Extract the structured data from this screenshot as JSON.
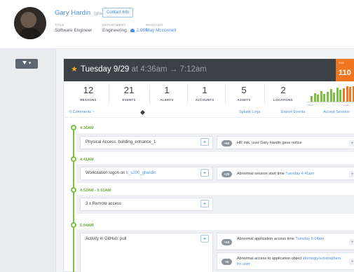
{
  "user": {
    "name": "Gary Hardin",
    "handle": "(ghardin)",
    "contact_label": "Contact Info",
    "title_label": "TITLE",
    "title_value": "Software Engineer",
    "department_label": "DEPARTMENT",
    "department_value": "Engineering",
    "department_count": "2,069",
    "manager_label": "MANAGER",
    "manager_value": "May Mcconnell"
  },
  "filter_label": "▾",
  "session": {
    "star": "★",
    "date": "Tuesday 9/29",
    "time_range": "at 4:36am → 7:12am",
    "risk_label": "RISK",
    "risk_score": "110",
    "stats": [
      {
        "value": "12",
        "label": "REASONS"
      },
      {
        "value": "21",
        "label": "EVENTS"
      },
      {
        "value": "1",
        "label": "ALERTS"
      },
      {
        "value": "1",
        "label": "ACCOUNTS"
      },
      {
        "value": "5",
        "label": "ASSETS"
      },
      {
        "value": "2",
        "label": "LOCATIONS"
      }
    ],
    "sparkline": {
      "bars": [
        0.35,
        0.55,
        0.45,
        0.7,
        0.5,
        0.65,
        0.8,
        0.6,
        0.9,
        0.75,
        0.85,
        1.0,
        0.95,
        1.0
      ],
      "colors": [
        "#7bc043",
        "#7bc043",
        "#7bc043",
        "#7bc043",
        "#7bc043",
        "#7bc043",
        "#7bc043",
        "#7bc043",
        "#7bc043",
        "#7bc043",
        "#f0761f",
        "#f0761f",
        "#f0761f",
        "#f0761f"
      ],
      "start_label": "4:36AM",
      "end_label": "7:12AM"
    },
    "comments_label": "0 Comments ~",
    "splunk_label": "Splunk Logs",
    "export_label": "Export Events",
    "accept_label": "Accept Session"
  },
  "timeline": [
    {
      "time": "4:36AM",
      "event": "Physical Access: building_entrance_1",
      "event_link": "",
      "reasons": [
        {
          "score": "+50",
          "text": "HR risk, user Gary Hardin gave notice",
          "link": ""
        }
      ]
    },
    {
      "time": "4:41AM",
      "event": "Workstation logon on ",
      "event_link": "lt_s200_ghardin",
      "reasons": [
        {
          "score": "+20",
          "text": "Abnormal session start time ",
          "link": "Tuesday 4:41am"
        }
      ]
    },
    {
      "time": "4:52AM - 5:01AM",
      "event": "3 x Remote access",
      "event_link": "",
      "reasons": []
    },
    {
      "time": "5:04AM",
      "event": "Activity in GitHub: pull",
      "event_link": "",
      "reasons": [
        {
          "score": "+10",
          "text": "Abnormal application access time ",
          "link": "Tuesday 5:04am"
        },
        {
          "score": "+5",
          "text": "Abnormal access to application object ",
          "link": "idornegly/a bstraphers for user"
        }
      ]
    }
  ],
  "colors": {
    "accent": "#4a90d9",
    "title_bar": "#3c4146",
    "risk": "#f0761f",
    "timeline": "#7bc043"
  }
}
